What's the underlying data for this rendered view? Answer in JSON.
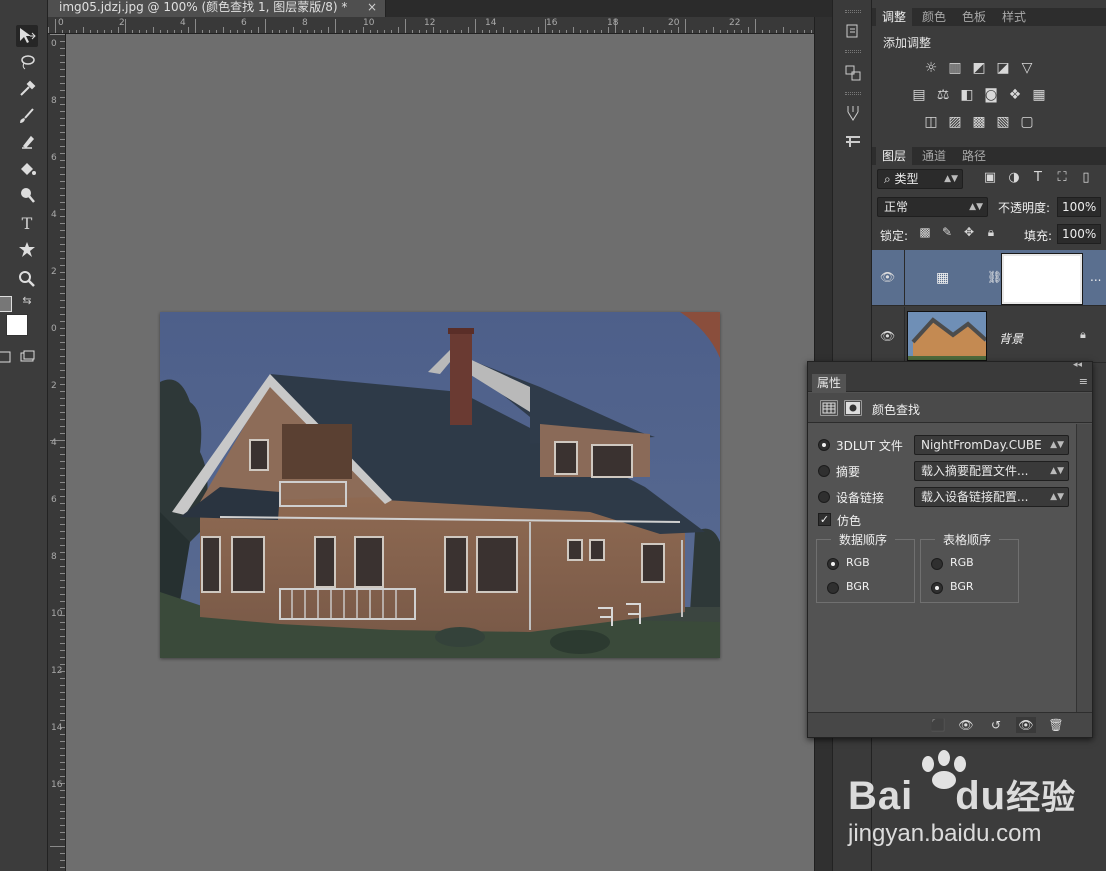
{
  "document": {
    "tab_title": "img05.jdzj.jpg @ 100% (颜色查找 1, 图层蒙版/8) *",
    "close_glyph": "×"
  },
  "rulers": {
    "top_ticks": [
      "0",
      "2",
      "4",
      "6",
      "8",
      "10",
      "12",
      "14",
      "16",
      "18",
      "20",
      "22"
    ],
    "left_ticks": [
      "0",
      "8",
      "6",
      "4",
      "2",
      "0",
      "2",
      "4",
      "6",
      "8",
      "10",
      "12",
      "14",
      "16"
    ]
  },
  "toolbar": {
    "tools": [
      "move-tool",
      "lasso-tool",
      "eyedropper-tool",
      "brush-tool",
      "clone-stamp-tool",
      "paint-bucket-tool",
      "dodge-tool",
      "type-tool",
      "custom-shape-tool",
      "zoom-tool"
    ],
    "type_glyph": "T"
  },
  "adjustments_panel": {
    "tabs": [
      "调整",
      "颜色",
      "色板",
      "样式"
    ],
    "heading": "添加调整",
    "icons_row1": [
      "brightness-icon",
      "levels-icon",
      "curves-icon",
      "exposure-icon",
      "vibrance-icon"
    ],
    "icons_row2": [
      "hue-saturation-icon",
      "color-balance-icon",
      "black-white-icon",
      "photo-filter-icon",
      "channel-mixer-icon",
      "color-lookup-icon"
    ],
    "icons_row3": [
      "invert-icon",
      "posterize-icon",
      "threshold-icon",
      "gradient-map-icon",
      "selective-color-icon"
    ]
  },
  "layers_panel": {
    "tabs": [
      "图层",
      "通道",
      "路径"
    ],
    "filter_kind": "类型",
    "blend_mode": "正常",
    "opacity_label": "不透明度:",
    "opacity_value": "100%",
    "lock_label": "锁定:",
    "fill_label": "填充:",
    "fill_value": "100%",
    "layers": [
      {
        "name": "",
        "type": "adjustment",
        "selected": true,
        "more": "..."
      },
      {
        "name": "背景",
        "type": "image",
        "selected": false
      }
    ]
  },
  "properties_panel": {
    "tab": "属性",
    "title": "颜色查找",
    "options": [
      {
        "label": "3DLUT 文件",
        "value": "NightFromDay.CUBE",
        "selected": true
      },
      {
        "label": "摘要",
        "value": "载入摘要配置文件...",
        "selected": false
      },
      {
        "label": "设备链接",
        "value": "载入设备链接配置...",
        "selected": false
      }
    ],
    "dither_label": "仿色",
    "dither_checked": true,
    "data_order": {
      "title": "数据顺序",
      "options": [
        "RGB",
        "BGR"
      ],
      "selected": "RGB"
    },
    "table_order": {
      "title": "表格顺序",
      "options": [
        "RGB",
        "BGR"
      ],
      "selected": "BGR"
    }
  },
  "watermark": {
    "brand": "Bai",
    "brand2": "du",
    "brand_cn": "经验",
    "url": "jingyan.baidu.com"
  }
}
